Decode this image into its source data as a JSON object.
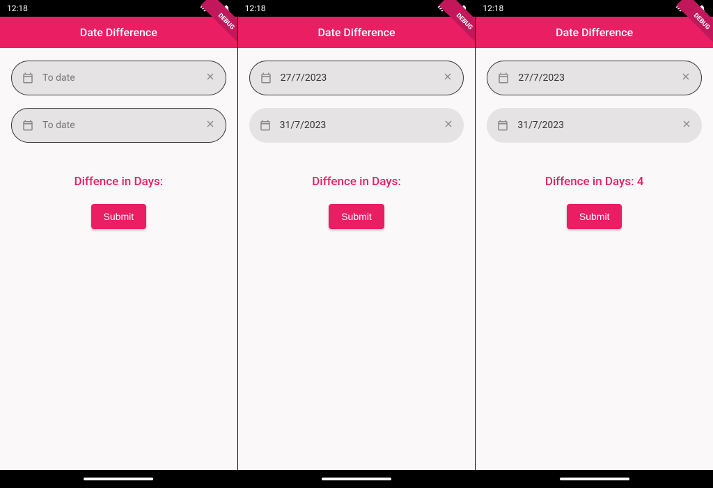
{
  "status": {
    "time": "12:18"
  },
  "app_title": "Date Difference",
  "debug_label": "DEBUG",
  "submit_label": "Submit",
  "clear_glyph": "×",
  "screens": [
    {
      "field1": {
        "value": "",
        "placeholder": "To date",
        "bordered": true
      },
      "field2": {
        "value": "",
        "placeholder": "To date",
        "bordered": true
      },
      "result": "Diffence in Days:"
    },
    {
      "field1": {
        "value": "27/7/2023",
        "placeholder": "To date",
        "bordered": true
      },
      "field2": {
        "value": "31/7/2023",
        "placeholder": "To date",
        "bordered": false
      },
      "result": "Diffence in Days:"
    },
    {
      "field1": {
        "value": "27/7/2023",
        "placeholder": "To date",
        "bordered": true
      },
      "field2": {
        "value": "31/7/2023",
        "placeholder": "To date",
        "bordered": false
      },
      "result": "Diffence in Days: 4"
    }
  ]
}
